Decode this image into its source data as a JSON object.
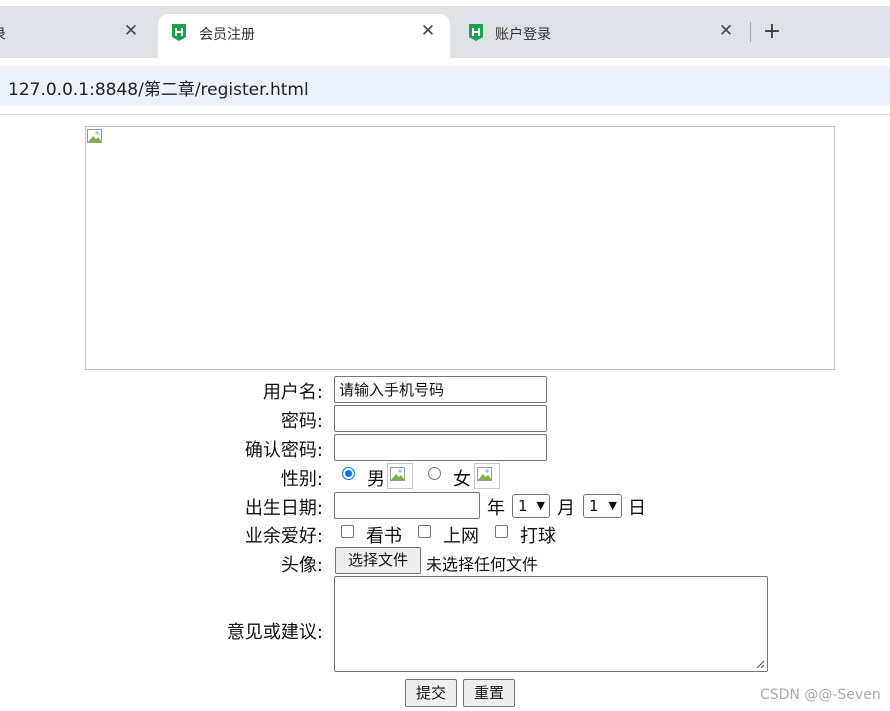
{
  "browser": {
    "tabs": [
      {
        "title": "",
        "partial_glyph": "录",
        "active": false
      },
      {
        "title": "会员注册",
        "active": true
      },
      {
        "title": "账户登录",
        "active": false
      }
    ],
    "close_glyph": "✕",
    "new_tab_glyph": "+",
    "url": "127.0.0.1:8848/第二章/register.html",
    "favicon_color": "#17a34a"
  },
  "form": {
    "username": {
      "label": "用户名:",
      "value": "请输入手机号码"
    },
    "password": {
      "label": "密码:",
      "value": ""
    },
    "confirm": {
      "label": "确认密码:",
      "value": ""
    },
    "gender": {
      "label": "性别:",
      "male": "男",
      "female": "女",
      "selected": "男"
    },
    "birthday": {
      "label": "出生日期:",
      "year_value": "",
      "year_text": "年",
      "month_value": "1",
      "month_text": "月",
      "day_value": "1",
      "day_text": "日"
    },
    "hobbies": {
      "label": "业余爱好:",
      "options": [
        "看书",
        "上网",
        "打球"
      ]
    },
    "avatar": {
      "label": "头像:",
      "button": "选择文件",
      "status": "未选择任何文件"
    },
    "feedback": {
      "label": "意见或建议:"
    },
    "submit": "提交",
    "reset": "重置"
  },
  "watermark": "CSDN @@-Seven",
  "colors": {
    "accent": "#0075ff",
    "tab_strip": "#dee1e6",
    "omnibox": "#edf2fa"
  }
}
